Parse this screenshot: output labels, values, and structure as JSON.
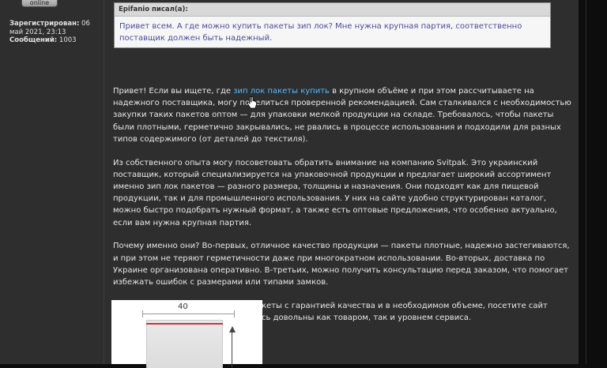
{
  "user_panel": {
    "status_label": "online",
    "registered_label": "Зарегистрирован:",
    "registered_value": "06 май 2021, 23:13",
    "posts_label": "Сообщений:",
    "posts_value": "1003"
  },
  "quote": {
    "author": "Epifanio писал(а):",
    "text": "Привет всем. А где можно купить пакеты зип лок? Мне нужна крупная партия, соответственно поставщик должен быть надежный."
  },
  "post": {
    "p1_before": "Привет! Если вы ищете, где ",
    "p1_link": "зип лок пакеты купить",
    "p1_after": " в крупном объёме и при этом рассчитываете на надежного поставщика, могу поделиться проверенной рекомендацией. Сам сталкивался с необходимостью закупки таких пакетов оптом — для упаковки мелкой продукции на складе. Требовалось, чтобы пакеты были плотными, герметично закрывались, не рвались в процессе использования и подходили для разных типов содержимого (от деталей до текстиля).",
    "p2": "Из собственного опыта могу посоветовать обратить внимание на компанию Svitpak. Это украинский поставщик, который специализируется на упаковочной продукции и предлагает широкий ассортимент именно зип лок пакетов — разного размера, толщины и назначения. Они подходят как для пищевой продукции, так и для промышленного использования. У них на сайте удобно структурирован каталог, можно быстро подобрать нужный формат, а также есть оптовые предложения, что особенно актуально, если вам нужна крупная партия.",
    "p3": "Почему именно они? Во-первых, отличное качество продукции — пакеты плотные, надежно застегиваются, и при этом не теряют герметичности даже при многократном использовании. Во-вторых, доставка по Украине организована оперативно. В-третьих, можно получить консультацию перед заказом, что помогает избежать ошибок с размерами или типами замков.",
    "p4": "Так что если вам нужны зип лок пакеты с гарантией качества и в необходимом объеме, посетите сайт компании. Уверен, что вы останетесь довольны как товаром, так и уровнем сервиса."
  },
  "image": {
    "dimension_label": "40"
  },
  "colors": {
    "page_bg": "#0d0d0d",
    "panel_bg": "#2e2e2e",
    "link": "#56b8ff",
    "quote_text": "#4a4a9a",
    "zip_red": "#d0323a"
  },
  "icons": {
    "cursor": "hand-pointer-icon"
  }
}
